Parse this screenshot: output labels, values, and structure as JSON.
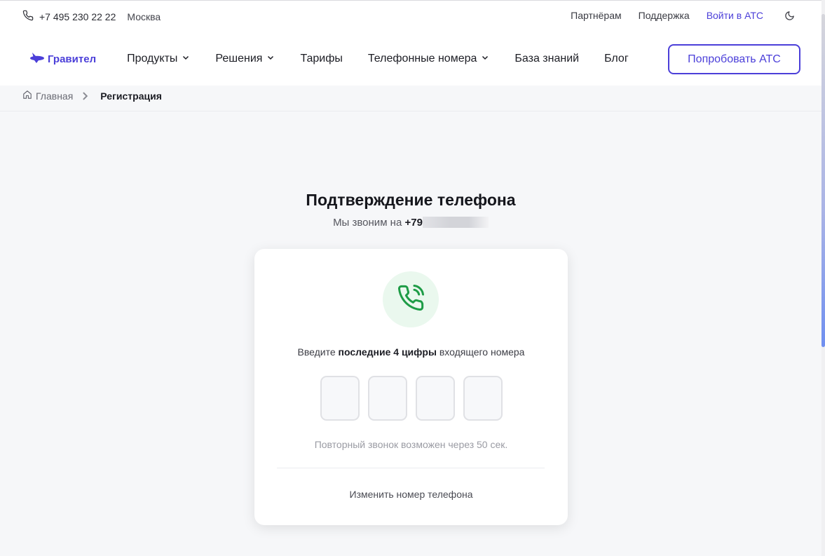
{
  "topbar": {
    "phone": "+7 495 230 22 22",
    "city": "Москва",
    "links": {
      "partners": "Партнёрам",
      "support": "Поддержка",
      "login": "Войти в АТС"
    }
  },
  "nav": {
    "logo": "Гравител",
    "items": [
      {
        "label": "Продукты",
        "dropdown": true
      },
      {
        "label": "Решения",
        "dropdown": true
      },
      {
        "label": "Тарифы",
        "dropdown": false
      },
      {
        "label": "Телефонные номера",
        "dropdown": true
      },
      {
        "label": "База знаний",
        "dropdown": false
      },
      {
        "label": "Блог",
        "dropdown": false
      }
    ],
    "cta": "Попробовать АТС"
  },
  "breadcrumb": {
    "home": "Главная",
    "current": "Регистрация"
  },
  "main": {
    "title": "Подтверждение телефона",
    "subtitle_prefix": "Мы звоним на ",
    "phone_visible": "+79"
  },
  "card": {
    "instruction_pre": "Введите ",
    "instruction_bold": "последние 4 цифры",
    "instruction_post": " входящего номера",
    "code_values": [
      "",
      "",
      "",
      ""
    ],
    "resend": "Повторный звонок возможен через 50 сек.",
    "change_number": "Изменить номер телефона"
  },
  "colors": {
    "accent": "#4b3fd9",
    "success": "#1e9c46",
    "background": "#f6f7f9"
  },
  "icons": [
    "phone-icon",
    "moon-icon",
    "logo-icon",
    "chevron-down-icon",
    "home-icon",
    "chevron-right-icon",
    "phone-calling-icon"
  ]
}
